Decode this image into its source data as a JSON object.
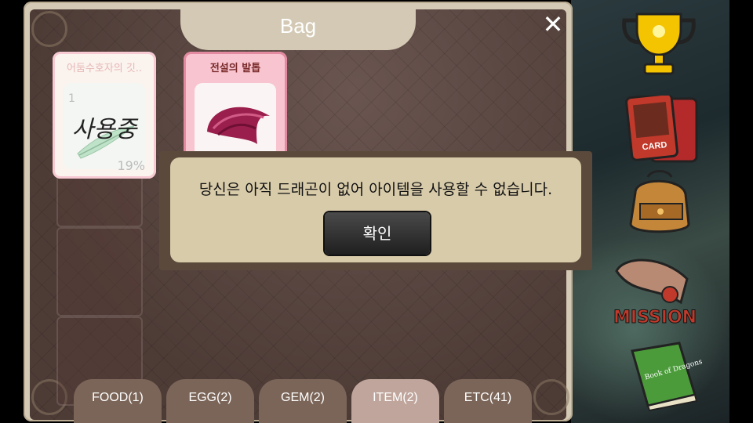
{
  "bag": {
    "title": "Bag",
    "close_glyph": "✕",
    "items": [
      {
        "name": "어둠수호자의 깃..",
        "quantity": "1",
        "status_label": "사용중",
        "percent": "19%"
      },
      {
        "name": "전설의 발톱"
      }
    ]
  },
  "dialog": {
    "message": "당신은 아직 드래곤이 없어 아이템을 사용할 수 없습니다.",
    "confirm_label": "확인"
  },
  "tabs": [
    {
      "label": "FOOD(1)"
    },
    {
      "label": "EGG(2)"
    },
    {
      "label": "GEM(2)"
    },
    {
      "label": "ITEM(2)",
      "active": true
    },
    {
      "label": "ETC(41)"
    }
  ],
  "side_menu": {
    "card_label": "CARD",
    "mission_label": "MISSION",
    "book_label": "Book of Dragons"
  },
  "colors": {
    "dialog_bg": "#d8cbaa",
    "active_tab": "#bfa59b",
    "tab": "#7b6558",
    "mission_text": "#c0392b"
  }
}
